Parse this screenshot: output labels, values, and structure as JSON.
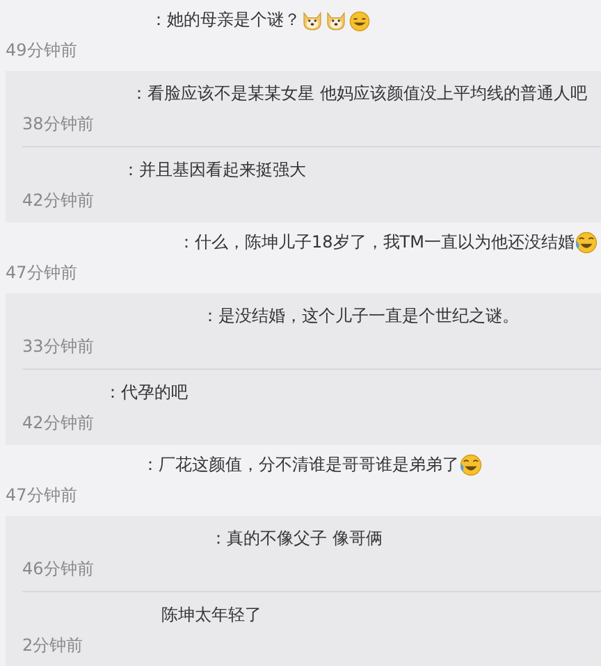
{
  "threads": [
    {
      "comment": {
        "text": "：她的母亲是个谜？",
        "emojis": [
          {
            "kind": "dog"
          },
          {
            "kind": "dog"
          },
          {
            "kind": "grin"
          }
        ],
        "time": "49分钟前"
      },
      "replies": [
        {
          "text": "：看脸应该不是某某女星 他妈应该颜值没上平均线的普通人吧",
          "time": "38分钟前"
        },
        {
          "text": "：并且基因看起来挺强大",
          "time": "42分钟前"
        }
      ]
    },
    {
      "comment": {
        "text": "：什么，陈坤儿子18岁了，我TM一直以为他还没结婚",
        "emojis": [
          {
            "kind": "laugh-cry"
          }
        ],
        "time": "47分钟前"
      },
      "replies": [
        {
          "text": "：是没结婚，这个儿子一直是个世纪之谜。",
          "time": "33分钟前"
        },
        {
          "text": "：代孕的吧",
          "time": "42分钟前"
        }
      ]
    },
    {
      "comment": {
        "text": "：厂花这颜值，分不清谁是哥哥谁是弟弟了",
        "emojis": [
          {
            "kind": "laugh-cry"
          }
        ],
        "time": "47分钟前"
      },
      "replies": [
        {
          "text": "：真的不像父子 像哥俩",
          "time": "46分钟前"
        },
        {
          "text": "陈坤太年轻了",
          "time": "2分钟前"
        }
      ]
    }
  ]
}
